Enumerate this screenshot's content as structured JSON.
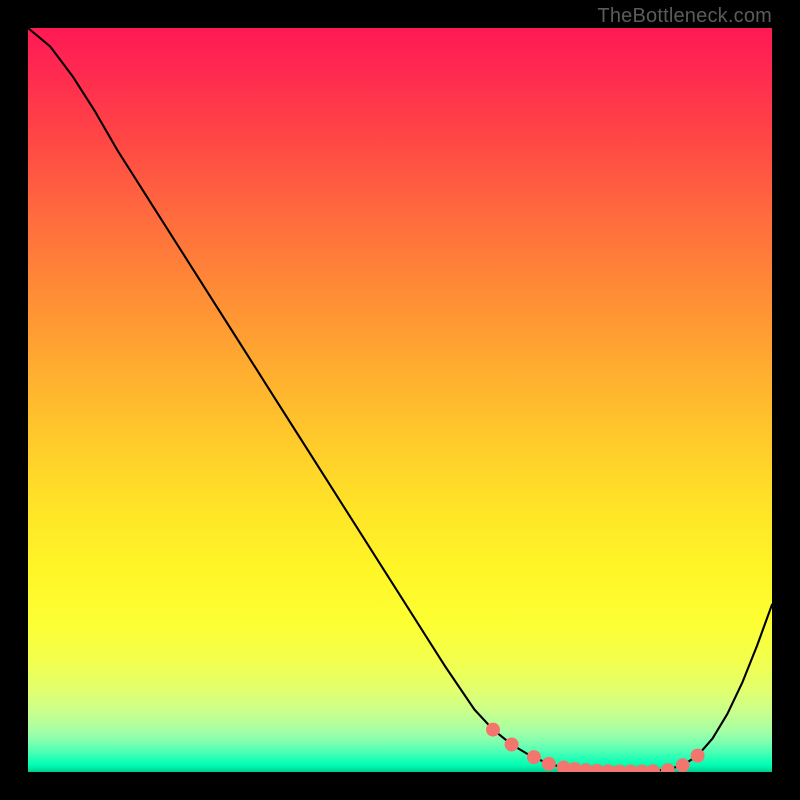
{
  "attribution": "TheBottleneck.com",
  "colors": {
    "background": "#000000",
    "curve": "#000000",
    "marker": "#f3766e"
  },
  "chart_data": {
    "type": "line",
    "title": "",
    "xlabel": "",
    "ylabel": "",
    "xlim": [
      0,
      100
    ],
    "ylim": [
      0,
      100
    ],
    "x": [
      0,
      3,
      6,
      9,
      12,
      16,
      20,
      24,
      28,
      32,
      36,
      40,
      44,
      48,
      52,
      56,
      60,
      62.5,
      65,
      67.5,
      70,
      72,
      74,
      76,
      78,
      80,
      82,
      84,
      86,
      88,
      90,
      92,
      94,
      96,
      98,
      100
    ],
    "values": [
      100,
      97.5,
      93.5,
      88.8,
      83.6,
      77.3,
      71.0,
      64.7,
      58.4,
      52.1,
      45.8,
      39.5,
      33.2,
      26.9,
      20.6,
      14.3,
      8.4,
      5.7,
      3.7,
      2.2,
      1.1,
      0.6,
      0.3,
      0.15,
      0.08,
      0.05,
      0.08,
      0.15,
      0.35,
      0.9,
      2.2,
      4.5,
      7.8,
      12.0,
      17.0,
      22.5
    ],
    "markers": {
      "x": [
        62.5,
        65,
        68,
        70,
        72,
        73.5,
        75,
        76.5,
        78,
        79.5,
        81,
        82.5,
        84,
        86,
        88,
        90
      ],
      "values": [
        5.7,
        3.7,
        2.0,
        1.1,
        0.6,
        0.4,
        0.25,
        0.17,
        0.1,
        0.07,
        0.06,
        0.07,
        0.1,
        0.25,
        0.9,
        2.2
      ]
    },
    "description": "Bottleneck/optimality curve on rainbow gradient background. Curve descends from top-left, reaches a minimum near x≈80, then rises. Salmon markers cluster around the minimum."
  }
}
